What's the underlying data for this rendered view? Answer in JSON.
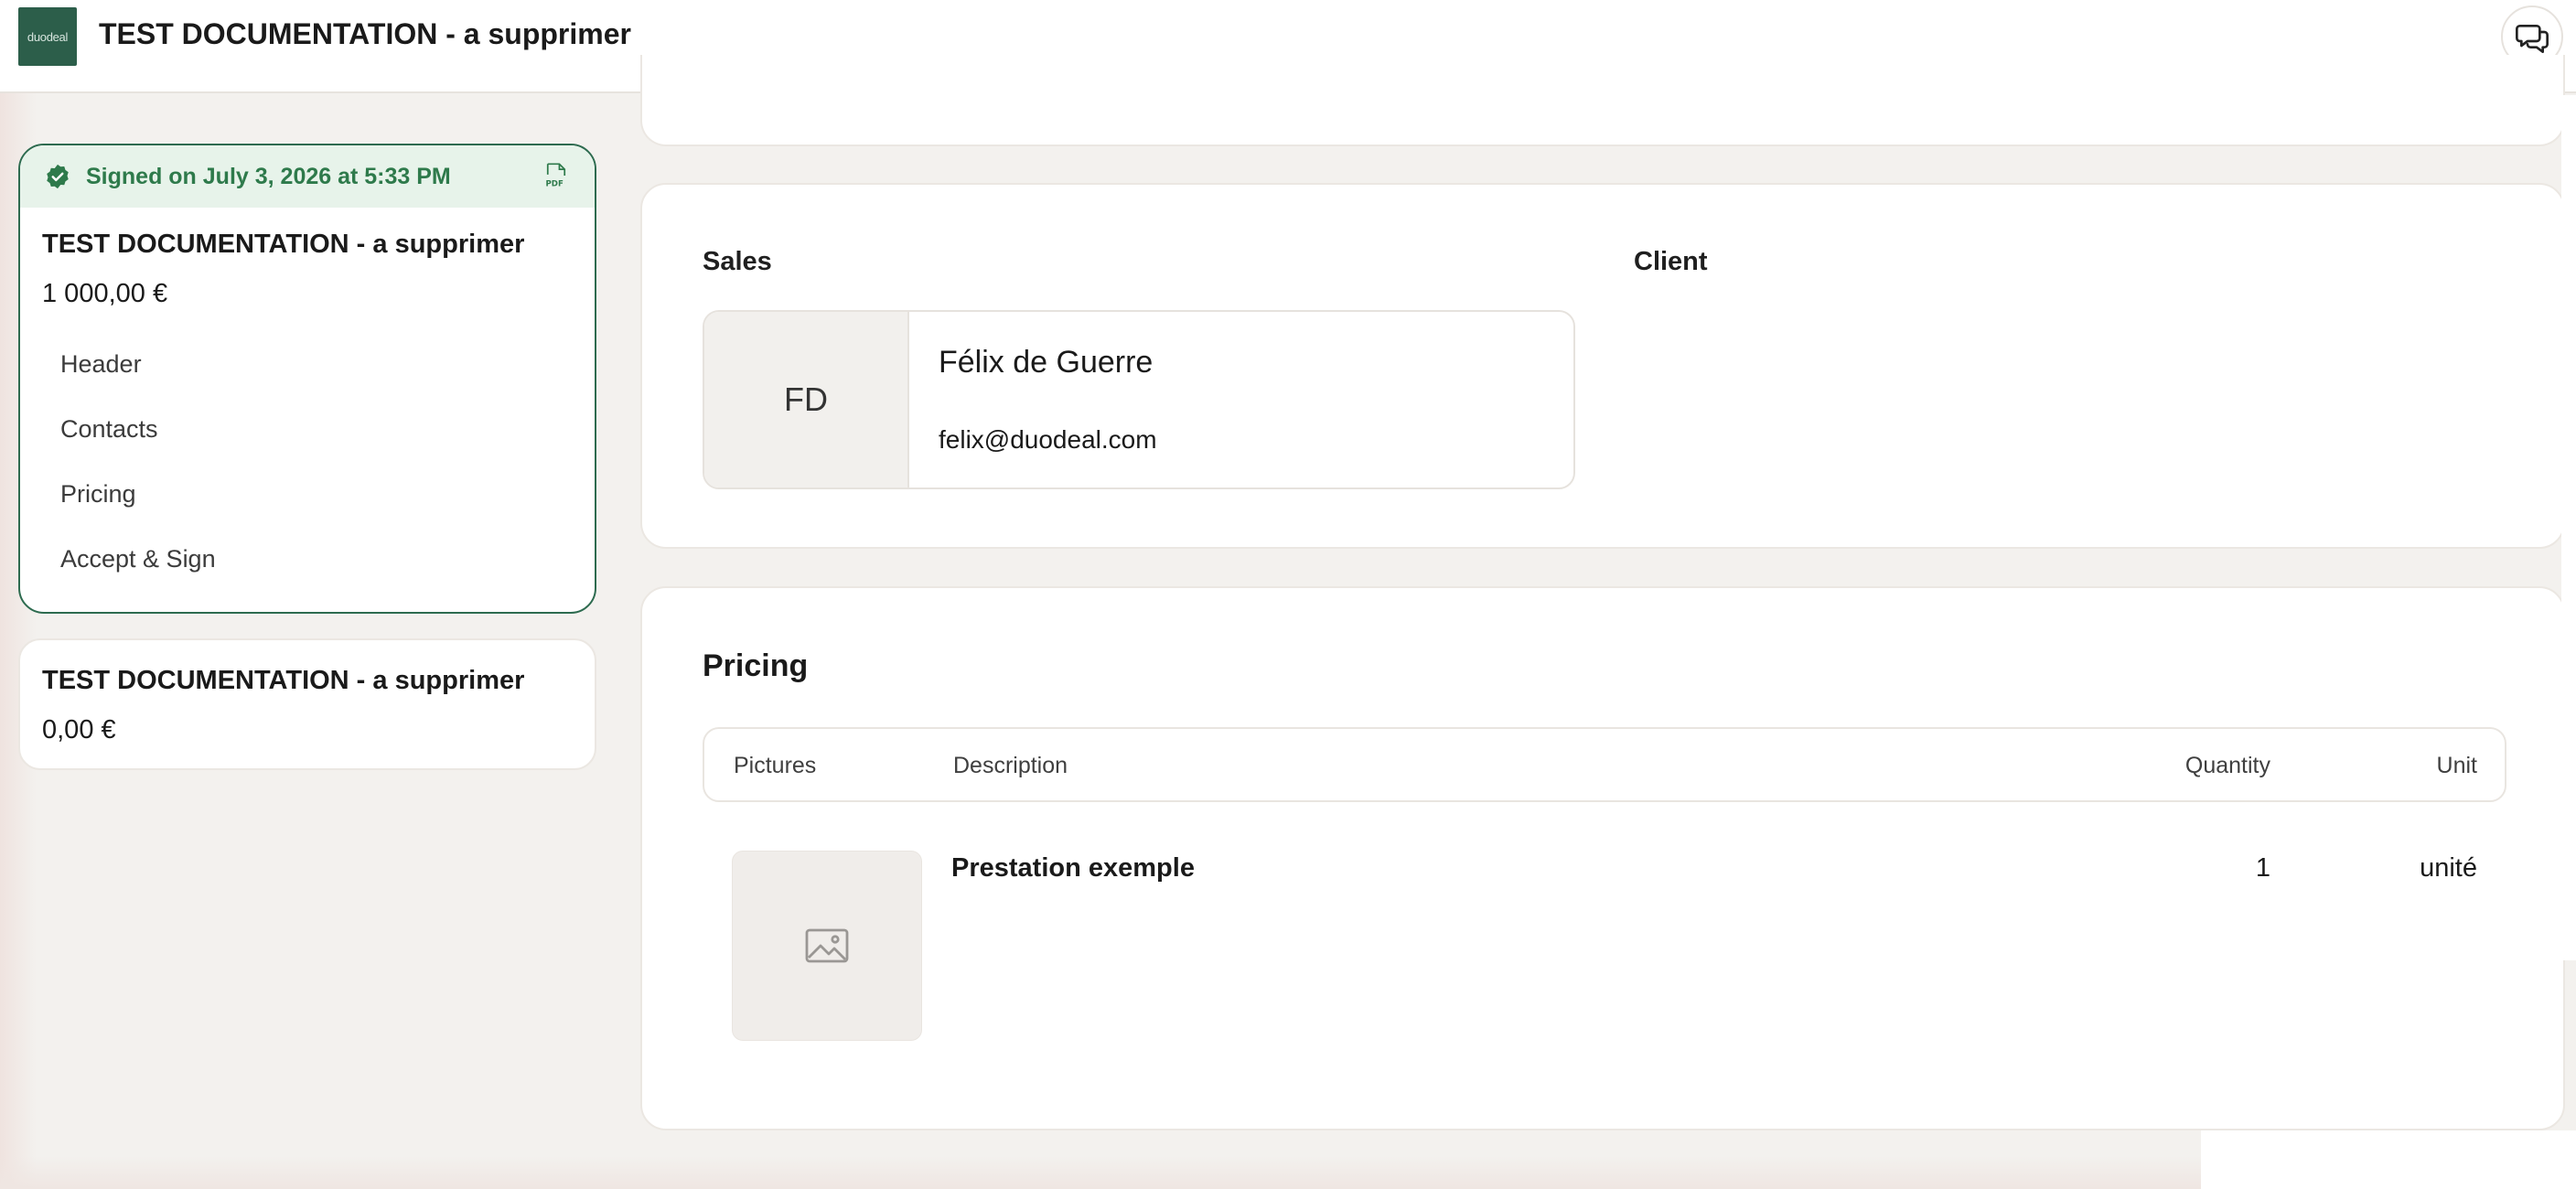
{
  "app": {
    "logo_text": "duodeal",
    "title": "TEST DOCUMENTATION - a supprimer",
    "chat_icon": "chat-bubbles-icon"
  },
  "sidebar": {
    "documents": [
      {
        "status": "Signed on July 3, 2026 at 5:33 PM",
        "status_icon": "check-badge-icon",
        "download_icon": "pdf-icon",
        "title": "TEST DOCUMENTATION - a supprimer",
        "amount": "1 000,00 €",
        "nav": [
          "Header",
          "Contacts",
          "Pricing",
          "Accept & Sign"
        ]
      },
      {
        "title": "TEST DOCUMENTATION - a supprimer",
        "amount": "0,00 €"
      }
    ]
  },
  "contacts": {
    "sales_label": "Sales",
    "client_label": "Client",
    "sales": {
      "initials": "FD",
      "name": "Félix de Guerre",
      "email": "felix@duodeal.com"
    }
  },
  "pricing": {
    "title": "Pricing",
    "columns": [
      "Pictures",
      "Description",
      "Quantity",
      "Unit"
    ],
    "rows": [
      {
        "picture_icon": "image-placeholder-icon",
        "description": "Prestation exemple",
        "quantity": "1",
        "unit": "unité"
      }
    ]
  },
  "colors": {
    "brand": "#2c5e4a",
    "signed_bg": "#e7f3ea",
    "signed_text": "#2e7a4b",
    "active_border": "#2d6b4f",
    "page_bg": "#f3f1ee"
  }
}
